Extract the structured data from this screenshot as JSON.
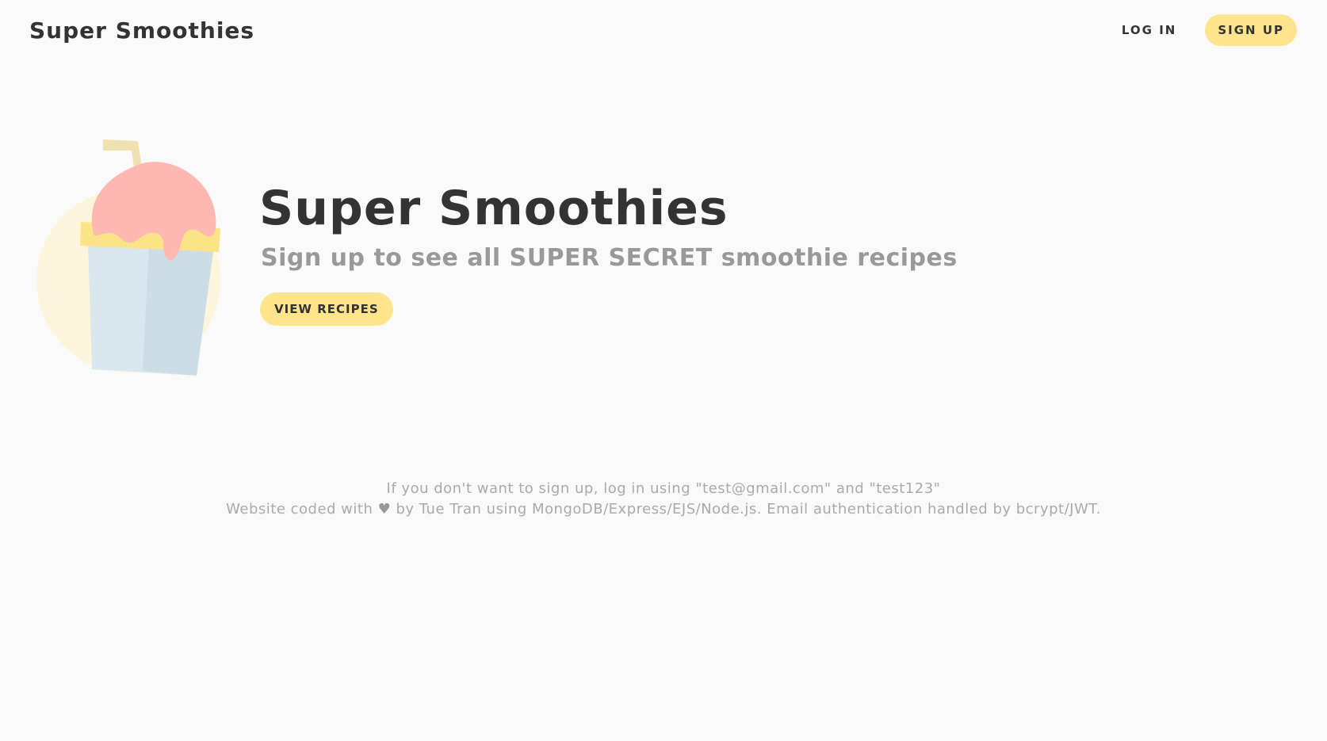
{
  "header": {
    "brand": "Super Smoothies",
    "login_label": "LOG IN",
    "signup_label": "SIGN UP"
  },
  "hero": {
    "illustration_icon": "smoothie-cup-icon",
    "title": "Super Smoothies",
    "subtitle": "Sign up to see all SUPER SECRET smoothie recipes",
    "cta_label": "VIEW RECIPES"
  },
  "footer": {
    "line1": "If you don't want to sign up, log in using \"test@gmail.com\" and \"test123\"",
    "line2_prefix": "Website coded with",
    "heart_icon": "heart-icon",
    "heart_glyph": "♥",
    "line2_suffix": "by Tue Tran using MongoDB/Express/EJS/Node.js. Email authentication handled by bcrypt/JWT."
  },
  "colors": {
    "accent": "#fee48c",
    "background": "#fafafa",
    "text": "#333333",
    "muted": "#999999",
    "cup": "#d8e6ed",
    "cream": "#ffb6b0"
  }
}
